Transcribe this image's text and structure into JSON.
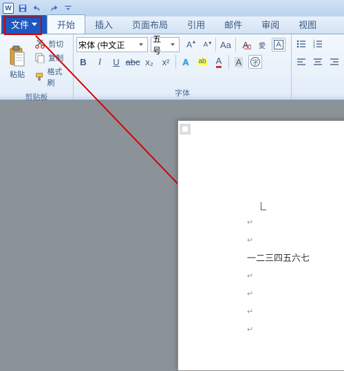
{
  "qat": {
    "app_letter": "W"
  },
  "tabs": {
    "file": "文件",
    "home": "开始",
    "insert": "插入",
    "layout": "页面布局",
    "references": "引用",
    "mail": "邮件",
    "review": "审阅",
    "view": "视图"
  },
  "clipboard": {
    "paste": "粘贴",
    "cut": "剪切",
    "copy": "复制",
    "format_painter": "格式刷",
    "group_label": "剪贴板"
  },
  "font": {
    "name": "宋体 (中文正",
    "size": "五号",
    "group_label": "字体",
    "clear": "Aa",
    "case": "Aa",
    "x2": "x₂",
    "x_sup": "x²",
    "abc": "abc",
    "circle_char": "字",
    "A_border": "A"
  },
  "doc": {
    "text_line": "一二三四五六七",
    "para_mark": "↵"
  },
  "colors": {
    "accent": "#1e58be",
    "annotation": "#d40000"
  }
}
